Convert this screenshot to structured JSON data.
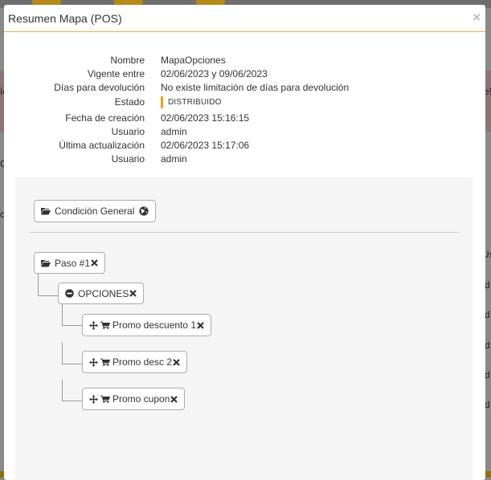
{
  "window": {
    "title": "Resumen Mapa (POS)",
    "close_glyph": "×"
  },
  "background": {
    "left_chars": [
      "ío",
      "C",
      "o"
    ],
    "right_chars": [
      "e!",
      "Us",
      "d",
      "d",
      "d",
      "d",
      "d"
    ]
  },
  "info": [
    {
      "label": "Nombre",
      "value": "MapaOpciones"
    },
    {
      "label": "Vigente entre",
      "value": "02/06/2023 y 09/06/2023"
    },
    {
      "label": "Días para devolución",
      "value": "No existe limitación de días para devolución"
    },
    {
      "label": "Estado",
      "value": "DISTRIBUIDO"
    },
    {
      "label": "Fecha de creación",
      "value": "02/06/2023 15:16:15"
    },
    {
      "label": "Usuario",
      "value": "admin"
    },
    {
      "label": "Última actualización",
      "value": "02/06/2023 15:17:06"
    },
    {
      "label": "Usuario",
      "value": "admin"
    }
  ],
  "colors": {
    "accent": "#f0ad4e",
    "status_bar": "#f0a30a"
  },
  "tree": {
    "general_condition": {
      "label": "Condición General",
      "icon": "folder-open-icon",
      "extra_icon": "globe-icon"
    },
    "step": {
      "label": "Paso #1",
      "icon": "folder-open-icon",
      "remove_icon": "remove-icon"
    },
    "options": {
      "label": "OPCIONES",
      "icon": "minus-circle-icon",
      "remove_icon": "remove-icon"
    },
    "promos": [
      {
        "label": "Promo descuento 1"
      },
      {
        "label": "Promo desc 2"
      },
      {
        "label": "Promo cupon"
      }
    ]
  }
}
